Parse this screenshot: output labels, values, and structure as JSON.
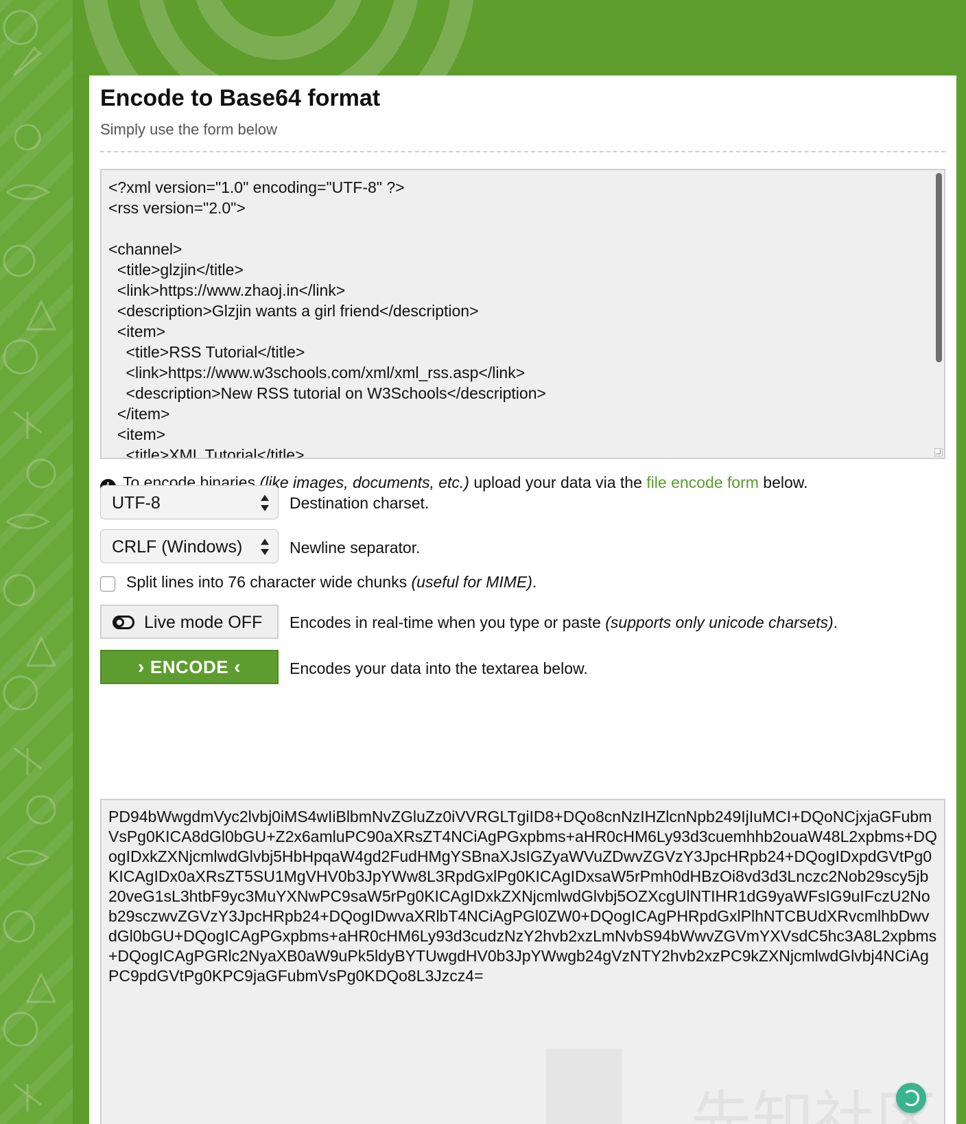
{
  "header": {
    "title": "Encode to Base64 format",
    "subtitle": "Simply use the form below"
  },
  "input": {
    "value": "<?xml version=\"1.0\" encoding=\"UTF-8\" ?>\n<rss version=\"2.0\">\n\n<channel>\n  <title>glzjin</title>\n  <link>https://www.zhaoj.in</link>\n  <description>Glzjin wants a girl friend</description>\n  <item>\n    <title>RSS Tutorial</title>\n    <link>https://www.w3schools.com/xml/xml_rss.asp</link>\n    <description>New RSS tutorial on W3Schools</description>\n  </item>\n  <item>\n    <title>XML Tutorial</title>"
  },
  "info": {
    "prefix": "To encode binaries ",
    "italic": "(like images, documents, etc.)",
    "middle": " upload your data via the ",
    "link": "file encode form",
    "suffix": " below."
  },
  "options": {
    "charset_value": "UTF-8",
    "charset_label": "Destination charset.",
    "newline_value": "CRLF (Windows)",
    "newline_label": "Newline separator.",
    "split_label": "Split lines into 76 character wide chunks ",
    "split_italic": "(useful for MIME)",
    "split_suffix": ".",
    "split_checked": false,
    "live_button": "Live mode OFF",
    "live_label": "Encodes in real-time when you type or paste ",
    "live_italic": "(supports only unicode charsets)",
    "live_suffix": ".",
    "encode_button": "ENCODE",
    "encode_label": "Encodes your data into the textarea below."
  },
  "output": {
    "value": "PD94bWwgdmVyc2lvbj0iMS4wIiBlbmNvZGluZz0iVVRGLTgiID8+DQo8cnNzIHZlcnNpb249IjIuMCI+DQoNCjxjaGFubmVsPg0KICA8dGl0bGU+Z2x6amluPC90aXRsZT4NCiAgPGxpbms+aHR0cHM6Ly93d3cuemhhb2ouaW48L2xpbms+DQogIDxkZXNjcmlwdGlvbj5HbHpqaW4gd2FudHMgYSBnaXJsIGZyaWVuZDwvZGVzY3JpcHRpb24+DQogIDxpdGVtPg0KICAgIDx0aXRsZT5SU1MgVHV0b3JpYWw8L3RpdGxlPg0KICAgIDxsaW5rPmh0dHBzOi8vd3d3Lnczc2Nob29scy5jb20veG1sL3htbF9yc3MuYXNwPC9saW5rPg0KICAgIDxkZXNjcmlwdGlvbj5OZXcgUlNTIHR1dG9yaWFsIG9uIFczU2Nob29sczwvZGVzY3JpcHRpb24+DQogIDwvaXRlbT4NCiAgPGl0ZW0+DQogICAgPHRpdGxlPlhNTCBUdXRvcmlhbDwvdGl0bGU+DQogICAgPGxpbms+aHR0cHM6Ly93d3cudzNzY2hvb2xzLmNvbS94bWwvZGVmYXVsdC5hc3A8L2xpbms+DQogICAgPGRlc2NyaXB0aW9uPk5ldyBYTUwgdHV0b3JpYWwgb24gVzNTY2hvb2xzPC9kZXNjcmlwdGlvbj4NCiAgPC9pdGVtPg0KPC9jaGFubmVsPg0KDQo8L3Jzcz4="
  },
  "watermark": {
    "text": "先知社区"
  },
  "colors": {
    "brand_green": "#5c9b2c",
    "link_green": "#5c9b2c"
  }
}
